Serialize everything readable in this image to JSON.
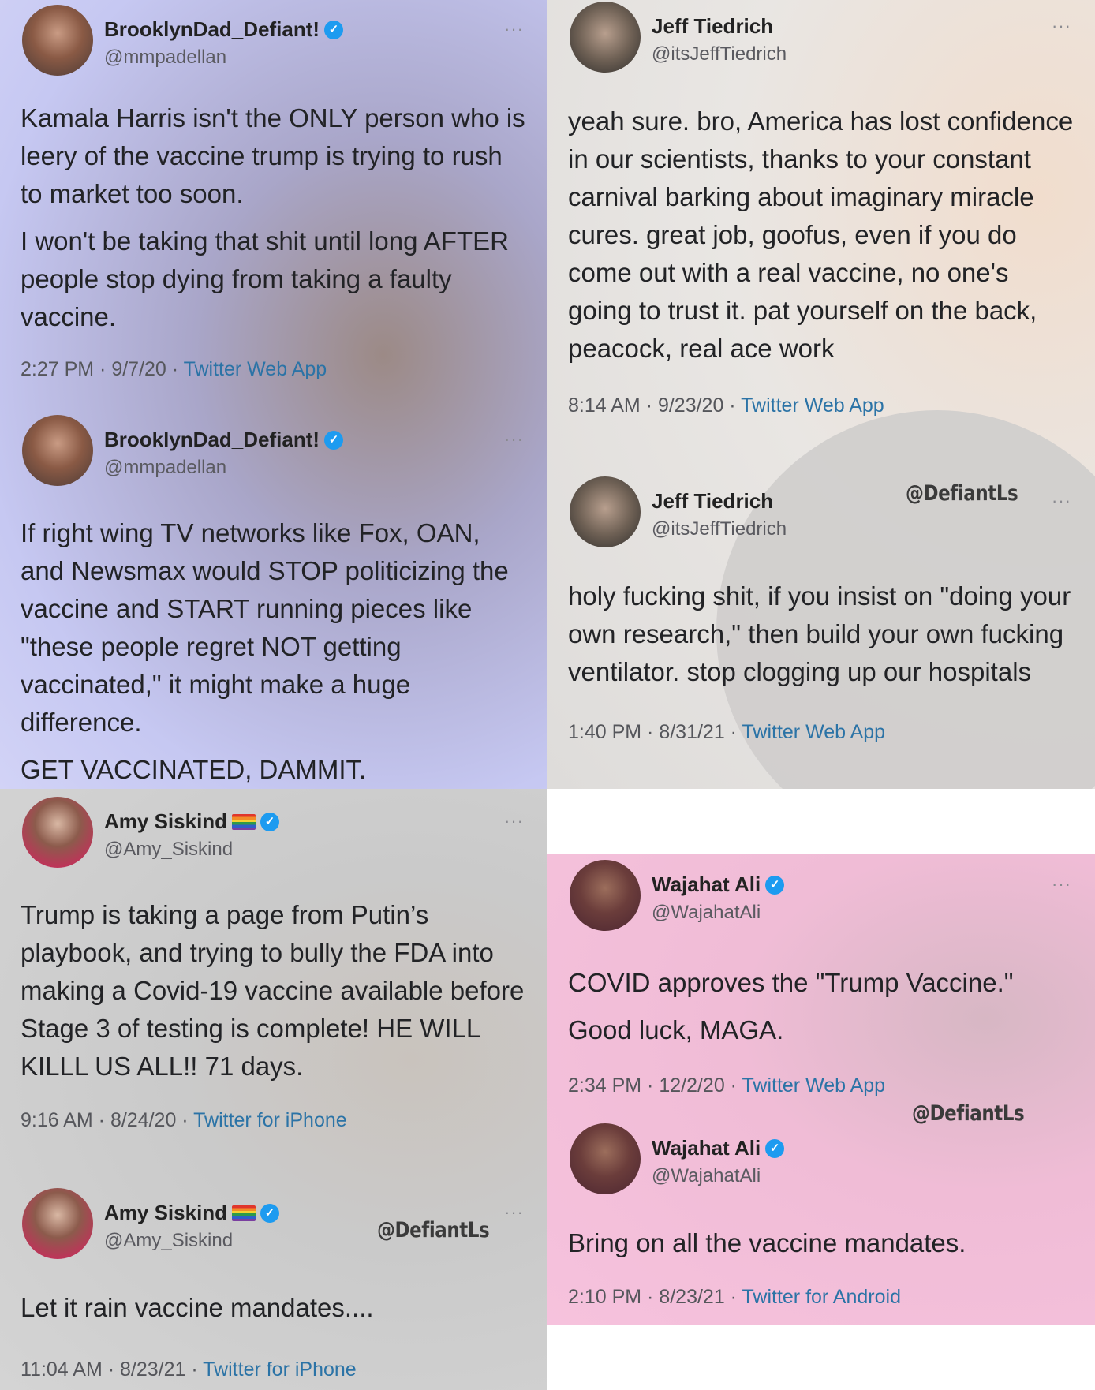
{
  "tweets": [
    {
      "name": "BrooklynDad_Defiant!",
      "handle": "@mmpadellan",
      "paragraphs": [
        "Kamala Harris isn't the ONLY person who is leery of the vaccine trump is trying to rush to market too soon.",
        "I won't be taking that shit until long AFTER people stop dying from taking a faulty vaccine."
      ],
      "time": "2:27 PM · 9/7/20 · ",
      "source": "Twitter Web App"
    },
    {
      "name": "BrooklynDad_Defiant!",
      "handle": "@mmpadellan",
      "paragraphs": [
        "If right wing TV networks like Fox, OAN, and Newsmax would STOP politicizing the vaccine and START running pieces like \"these people regret NOT getting vaccinated,\" it might make a huge difference.",
        "GET VACCINATED, DAMMIT."
      ]
    },
    {
      "name": "Jeff Tiedrich",
      "handle": "@itsJeffTiedrich",
      "paragraphs": [
        "yeah sure. bro, America has lost confidence in our scientists, thanks to your constant carnival barking about imaginary miracle cures. great job, goofus, even if you do come out with a real vaccine, no one's going to trust it. pat yourself on the back, peacock, real ace work"
      ],
      "time": "8:14 AM · 9/23/20 · ",
      "source": "Twitter Web App"
    },
    {
      "name": "Jeff Tiedrich",
      "handle": "@itsJeffTiedrich",
      "paragraphs": [
        "holy fucking shit, if you insist on \"doing your own research,\" then build your own fucking ventilator. stop clogging up our hospitals"
      ],
      "time": "1:40 PM · 8/31/21 · ",
      "source": "Twitter Web App"
    },
    {
      "name": "Amy Siskind",
      "handle": "@Amy_Siskind",
      "paragraphs": [
        "Trump is taking a page from Putin’s playbook, and trying to bully the FDA into making a Covid-19 vaccine available before Stage 3 of testing is complete!   HE WILL KILLL US ALL!! 71 days."
      ],
      "time": "9:16 AM · 8/24/20 · ",
      "source": "Twitter for iPhone"
    },
    {
      "name": "Amy Siskind",
      "handle": "@Amy_Siskind",
      "paragraphs": [
        "Let it rain vaccine mandates...."
      ],
      "time": "11:04 AM · 8/23/21 · ",
      "source": "Twitter for iPhone"
    },
    {
      "name": "Wajahat Ali",
      "handle": "@WajahatAli",
      "paragraphs": [
        "COVID approves the \"Trump Vaccine.\"",
        "Good luck, MAGA."
      ],
      "time": "2:34 PM · 12/2/20 · ",
      "source": "Twitter Web App"
    },
    {
      "name": "Wajahat Ali",
      "handle": "@WajahatAli",
      "paragraphs": [
        "Bring on all the vaccine mandates."
      ],
      "time": "2:10 PM · 8/23/21 · ",
      "source": "Twitter for Android"
    }
  ],
  "watermark": "@DefiantLs",
  "more_glyph": "···",
  "verified_glyph": "✓",
  "icons": {
    "verified": "verified-badge-icon",
    "more": "more-options-icon",
    "flag": "rainbow-flag-icon"
  },
  "colors": {
    "source_link": "#2b73a6",
    "verified": "#1d9bf0",
    "panel_tl": "#c6c8f2",
    "panel_br": "#f6c2dd"
  }
}
